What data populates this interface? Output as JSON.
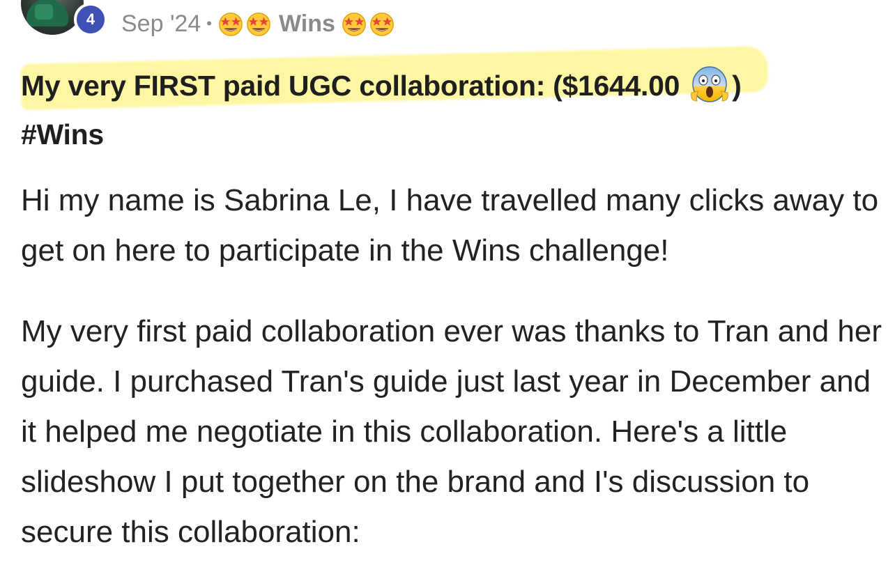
{
  "author": {
    "level": "4"
  },
  "meta": {
    "date": "Sep '24",
    "separator": "•",
    "category": "Wins",
    "category_emoji": "star-struck"
  },
  "post": {
    "title_main": "My very FIRST paid UGC collaboration: ($1644.00",
    "title_emoji": "face-screaming-in-fear",
    "title_close": ")",
    "hashtag": "#Wins",
    "paragraphs": [
      "Hi my name is Sabrina Le, I have travelled many clicks away to get on here to participate in the Wins challenge!",
      "My very first paid collaboration ever was thanks to Tran and her guide. I purchased Tran's guide just last year in December and it helped me negotiate in this collaboration. Here's a little slideshow I put together on the brand and I's discussion to secure this collaboration:"
    ]
  },
  "colors": {
    "badge": "#3f51b5",
    "highlight": "#fdf7a3",
    "meta_text": "#8a8a8a",
    "body_text": "#222222"
  }
}
